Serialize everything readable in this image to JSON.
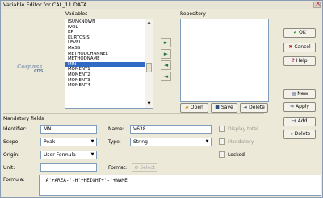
{
  "window": {
    "title": "Variable Editor for CAL_11.DATA"
  },
  "variables": {
    "label": "Variables",
    "items": [
      "ISUNKNOWN",
      "IVOL",
      "KP",
      "KURTOSIS",
      "LEVEL",
      "MASS",
      "METHODCHANNEL",
      "METHODNAME",
      "MIN",
      "MOMENT1",
      "MOMENT2",
      "MOMENT3",
      "MOMENT4"
    ],
    "selected_index": 8
  },
  "repository": {
    "label": "Repository"
  },
  "arrows": {
    "a1": "►",
    "a2": "►",
    "a3": "◄",
    "a4": "◄"
  },
  "buttons": {
    "ok": "OK",
    "cancel": "Cancel",
    "help": "Help",
    "new": "New",
    "apply": "Apply",
    "add": "Add",
    "delete": "Delete",
    "open": "Open",
    "save": "Save",
    "repo_delete": "Delete"
  },
  "logo": {
    "line1": "Corpass",
    "line2": "CDS"
  },
  "mandatory": {
    "label": "Mandatory fields",
    "identifier_label": "Identifier:",
    "identifier_value": "MN",
    "name_label": "Name:",
    "name_value": "V638",
    "display_total_label": "Display total",
    "scope_label": "Scope:",
    "scope_value": "Peak",
    "type_label": "Type:",
    "type_value": "String",
    "mandatory_label": "Mandatory",
    "origin_label": "Origin:",
    "origin_value": "User Formula",
    "locked_label": "Locked",
    "unit_label": "Unit:",
    "unit_value": "",
    "format_label": "Format:",
    "select_label": "Select",
    "formula_label": "Formula:",
    "formula_value": "'A'+AREA-'-H'+HEIGHT+'-'+NAME"
  },
  "colors": {
    "selection": "#316ac5",
    "arrow": "#1f7a3c",
    "close": "#c02060"
  }
}
